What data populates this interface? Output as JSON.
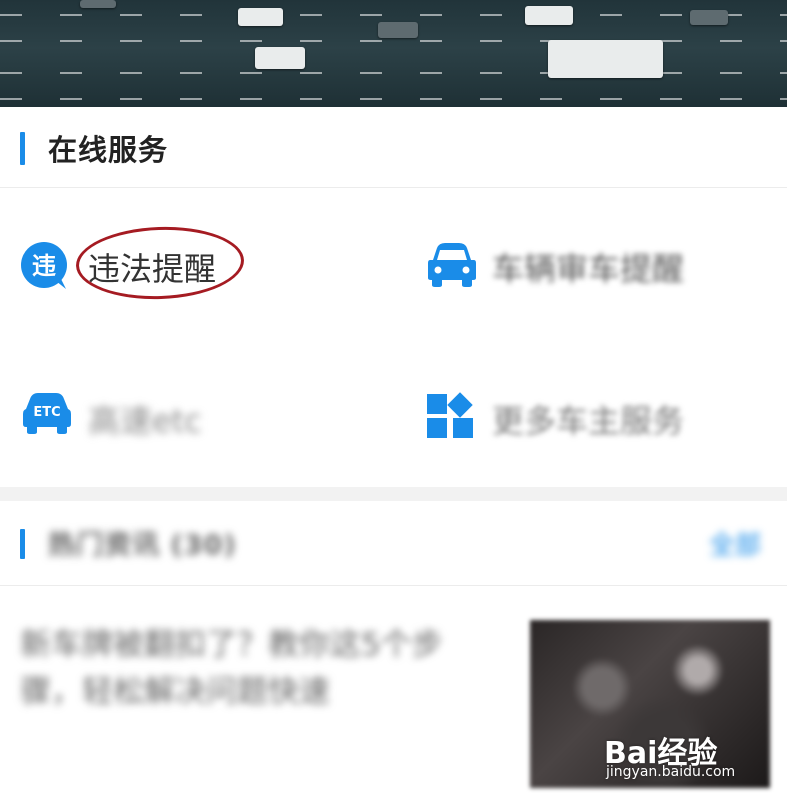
{
  "online_services": {
    "title": "在线服务",
    "items": [
      {
        "icon": "violation-icon",
        "icon_text": "违",
        "label": "违法提醒"
      },
      {
        "icon": "car-icon",
        "label": "车辆审车提醒"
      },
      {
        "icon": "etc-car-icon",
        "icon_text": "ETC",
        "label": "高速etc"
      },
      {
        "icon": "more-services-icon",
        "label": "更多车主服务"
      }
    ]
  },
  "news": {
    "title": "热门资讯 (30)",
    "more": "全部",
    "article_text": "新车牌被翻扣了？教你这5个步骤，轻松解决问题快速"
  },
  "watermark": {
    "brand": "Bai经验",
    "url": "jingyan.baidu.com"
  },
  "colors": {
    "accent": "#1a8ce8",
    "annotation": "#a51b22"
  }
}
